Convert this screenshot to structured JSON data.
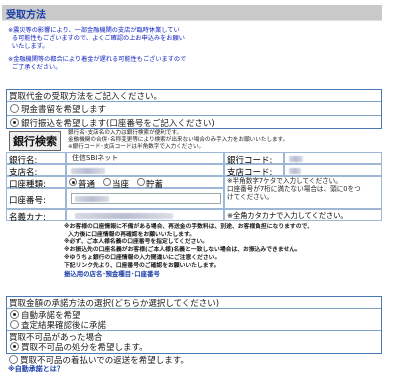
{
  "header": {
    "title": "受取方法"
  },
  "notices": [
    "※震災等の影響により、一部金融機関の支店が臨時休業してい\n  る可能性もございますので、よくご確認の上お申込みをお願い\n  いたします。",
    "※金融機関等の都合により着金が遅れる可能性もございますので\n  ご了承ください。"
  ],
  "receipt": {
    "heading": "買取代金の受取方法をご記入ください。",
    "options": [
      {
        "label": "現金書留を希望します",
        "selected": false
      },
      {
        "label": "銀行振込を希望します(口座番号をご記入ください)",
        "selected": true
      }
    ]
  },
  "bank_search": {
    "button": "銀行検索",
    "help": "銀行名･支店名の入力は銀行検索が便利です。\n金融機関の合併･名称変更等により検索が出来ない場合のみ手入力をお願いいたします。\n※銀行コード･支店コードは半角数字で入力ください。"
  },
  "form": {
    "bank_name_label": "銀行名:",
    "bank_name_value": "住信SBIネット",
    "bank_code_label": "銀行コード:",
    "branch_name_label": "支店名:",
    "branch_code_label": "支店コード:",
    "account_type_label": "口座種類:",
    "account_types": [
      {
        "label": "普通",
        "selected": true
      },
      {
        "label": "当座",
        "selected": false
      },
      {
        "label": "貯蓄",
        "selected": false
      }
    ],
    "account_number_label": "口座番号:",
    "account_number_hint": "※半角数字7ケタで入力してください。\n口座番号が7桁に満たない場合は、頭に0をつ\nけてください。",
    "account_holder_label": "名義カナ:",
    "account_holder_hint": "※全角カタカナで入力してください。"
  },
  "warnings": {
    "text": "※お客様の口座情報に不備がある場合、再送金の手数料は、別途、お客様負担になりますので、\n  入力後に口座情報の再確認をお願いいたします。\n※必ず、ご本人様名義の口座番号を指定してください。\n※お振込先の口座名義がお客様(ご本人様)名義と一致しない場合は、お振込みできません。\n※ゆうちょ銀行の口座情報の入力間違いにご注意ください。\n下記リンク先より、口座番号のご確認をお願いいたします。",
    "link": "振込用の店名･預金種目･口座番号"
  },
  "approval": {
    "heading": "買取金額の承諾方法の選択(どちらか選択してください)",
    "options": [
      {
        "label": "自動承諾を希望",
        "selected": true
      },
      {
        "label": "査定結果確認後に承諾",
        "selected": false
      }
    ],
    "unavailable_heading": "買取不可品があった場合",
    "unavailable_options": [
      {
        "label": "買取不可品の処分を希望します。",
        "selected": true
      },
      {
        "label": "買取不可品の着払いでの返送を希望します。",
        "selected": false
      }
    ],
    "footer_link": "※自動承諾とは？"
  }
}
